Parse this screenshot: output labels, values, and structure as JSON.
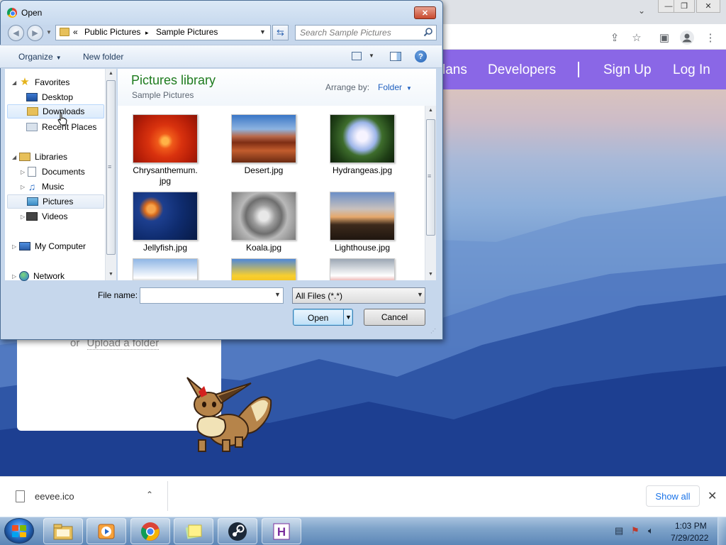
{
  "browser": {
    "window_controls": [
      "minimize-icon",
      "restore-icon",
      "close-icon"
    ],
    "toolbar_icons": [
      "share-icon",
      "star-icon",
      "side-panel-icon",
      "profile-icon",
      "menu-icon"
    ]
  },
  "site": {
    "nav": {
      "plans_partial": "lans",
      "developers": "Developers",
      "sign_up": "Sign Up",
      "log_in": "Log In"
    },
    "upload": {
      "or": "or",
      "link": "Upload a folder"
    },
    "colors": {
      "nav_bg": "#8a67e6"
    }
  },
  "download_bar": {
    "file_name": "eevee.ico",
    "show_all": "Show all"
  },
  "dialog": {
    "title": "Open",
    "address": {
      "prefix": "«",
      "seg1": "Public Pictures",
      "sep": "▸",
      "seg2": "Sample Pictures"
    },
    "search_placeholder": "Search Sample Pictures",
    "toolbar": {
      "organize": "Organize",
      "new_folder": "New folder"
    },
    "nav": {
      "favorites": "Favorites",
      "desktop": "Desktop",
      "downloads": "Downloads",
      "recent_places": "Recent Places",
      "libraries": "Libraries",
      "documents": "Documents",
      "music": "Music",
      "pictures": "Pictures",
      "videos": "Videos",
      "my_computer": "My Computer",
      "network": "Network"
    },
    "library": {
      "title": "Pictures library",
      "subtitle": "Sample Pictures",
      "arrange_label": "Arrange by:",
      "arrange_value": "Folder"
    },
    "files": [
      {
        "name": "Chrysanthemum.\njpg"
      },
      {
        "name": "Desert.jpg"
      },
      {
        "name": "Hydrangeas.jpg"
      },
      {
        "name": "Jellyfish.jpg"
      },
      {
        "name": "Koala.jpg"
      },
      {
        "name": "Lighthouse.jpg"
      },
      {
        "name": ""
      },
      {
        "name": ""
      },
      {
        "name": ""
      }
    ],
    "file_name_label": "File name:",
    "file_name_value": "",
    "filter": "All Files (*.*)",
    "open_button": "Open",
    "cancel_button": "Cancel"
  },
  "taskbar": {
    "apps": [
      "explorer-icon",
      "media-player-icon",
      "chrome-icon",
      "sticky-notes-icon",
      "steam-icon",
      "hx-icon"
    ],
    "time": "1:03 PM",
    "date": "7/29/2022"
  }
}
